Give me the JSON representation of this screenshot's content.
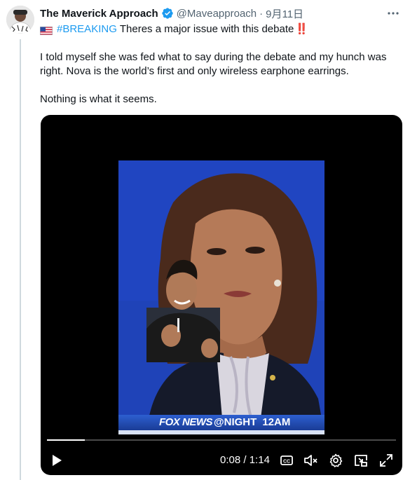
{
  "tweet": {
    "display_name": "The Maverick Approach",
    "handle": "@Maveapproach",
    "separator": "·",
    "date": "9月11日",
    "more_label": "···",
    "hashtag": "#BREAKING",
    "headline_text": "Theres a major issue with this debate",
    "headline_emoji": "‼️",
    "paragraphs": [
      "I told myself she was fed what to say during the debate and my hunch was right. Nova is the world’s first and only wireless earphone earrings.",
      "Nothing is what it seems."
    ]
  },
  "video": {
    "chyron_brand": "FOX NEWS",
    "chyron_show": "@NIGHT",
    "chyron_time": "12AM",
    "current_time": "0:08",
    "time_separator": "/",
    "duration": "1:14",
    "progress_fraction": 0.108,
    "controls": [
      "play-icon",
      "captions-icon",
      "mute-icon",
      "settings-icon",
      "pip-icon",
      "fullscreen-icon"
    ]
  },
  "colors": {
    "link": "#1d9bf0",
    "verified": "#1d9bf0",
    "muted_text": "#536471",
    "emoji_red": "#e0242f",
    "video_bg": "#000000"
  }
}
